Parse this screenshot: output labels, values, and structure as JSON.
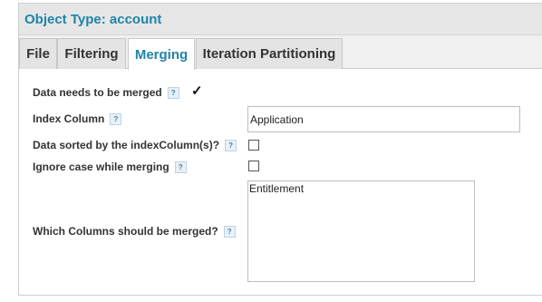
{
  "header": {
    "title": "Object Type: account"
  },
  "tabs": [
    {
      "label": "File"
    },
    {
      "label": "Filtering"
    },
    {
      "label": "Merging"
    },
    {
      "label": "Iteration Partitioning"
    }
  ],
  "active_tab": "Merging",
  "help_glyph": "?",
  "form": {
    "data_needs_merge": {
      "label": "Data needs to be merged",
      "checked": true,
      "check_glyph": "✓"
    },
    "index_column": {
      "label": "Index Column",
      "value": "Application"
    },
    "data_sorted": {
      "label": "Data sorted by the indexColumn(s)?",
      "checked": false
    },
    "ignore_case": {
      "label": "Ignore case while merging",
      "checked": false
    },
    "merge_columns": {
      "label": "Which Columns should be merged?",
      "value": "Entitlement"
    }
  },
  "colors": {
    "accent": "#1f84a8",
    "header_bg": "#e6e6e6",
    "tab_bg": "#e4e4e4"
  }
}
